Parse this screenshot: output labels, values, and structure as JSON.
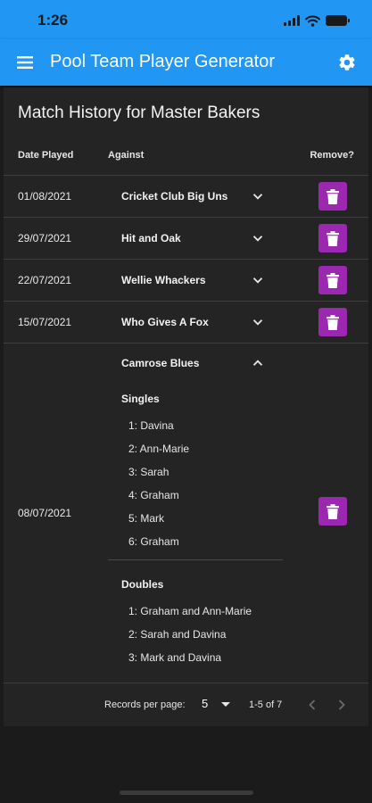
{
  "status": {
    "time": "1:26"
  },
  "appbar": {
    "title": "Pool Team Player Generator"
  },
  "card": {
    "title": "Match History for Master Bakers",
    "columns": {
      "date": "Date Played",
      "against": "Against",
      "remove": "Remove?"
    },
    "rows": [
      {
        "date": "01/08/2021",
        "against": "Cricket Club Big Uns",
        "expanded": false
      },
      {
        "date": "29/07/2021",
        "against": "Hit and Oak",
        "expanded": false
      },
      {
        "date": "22/07/2021",
        "against": "Wellie Whackers",
        "expanded": false
      },
      {
        "date": "15/07/2021",
        "against": "Who Gives A Fox",
        "expanded": false
      }
    ],
    "expanded_row": {
      "date": "08/07/2021",
      "against": "Camrose Blues",
      "singles_label": "Singles",
      "singles": [
        "1: Davina",
        "2: Ann-Marie",
        "3: Sarah",
        "4: Graham",
        "5: Mark",
        "6: Graham"
      ],
      "doubles_label": "Doubles",
      "doubles": [
        "1: Graham and Ann-Marie",
        "2: Sarah and Davina",
        "3: Mark and Davina"
      ]
    }
  },
  "pagination": {
    "label": "Records per page:",
    "per_page": "5",
    "range": "1-5 of 7"
  },
  "colors": {
    "primary": "#2196f3",
    "delete_button": "#9c27b0",
    "background": "#1b1b1b",
    "card": "#242424"
  },
  "icons": {
    "menu": "menu-icon",
    "settings": "gear-icon",
    "expand": "chevron-down-icon",
    "collapse": "chevron-up-icon",
    "delete": "trash-icon",
    "prev": "chevron-left-icon",
    "next": "chevron-right-icon"
  }
}
